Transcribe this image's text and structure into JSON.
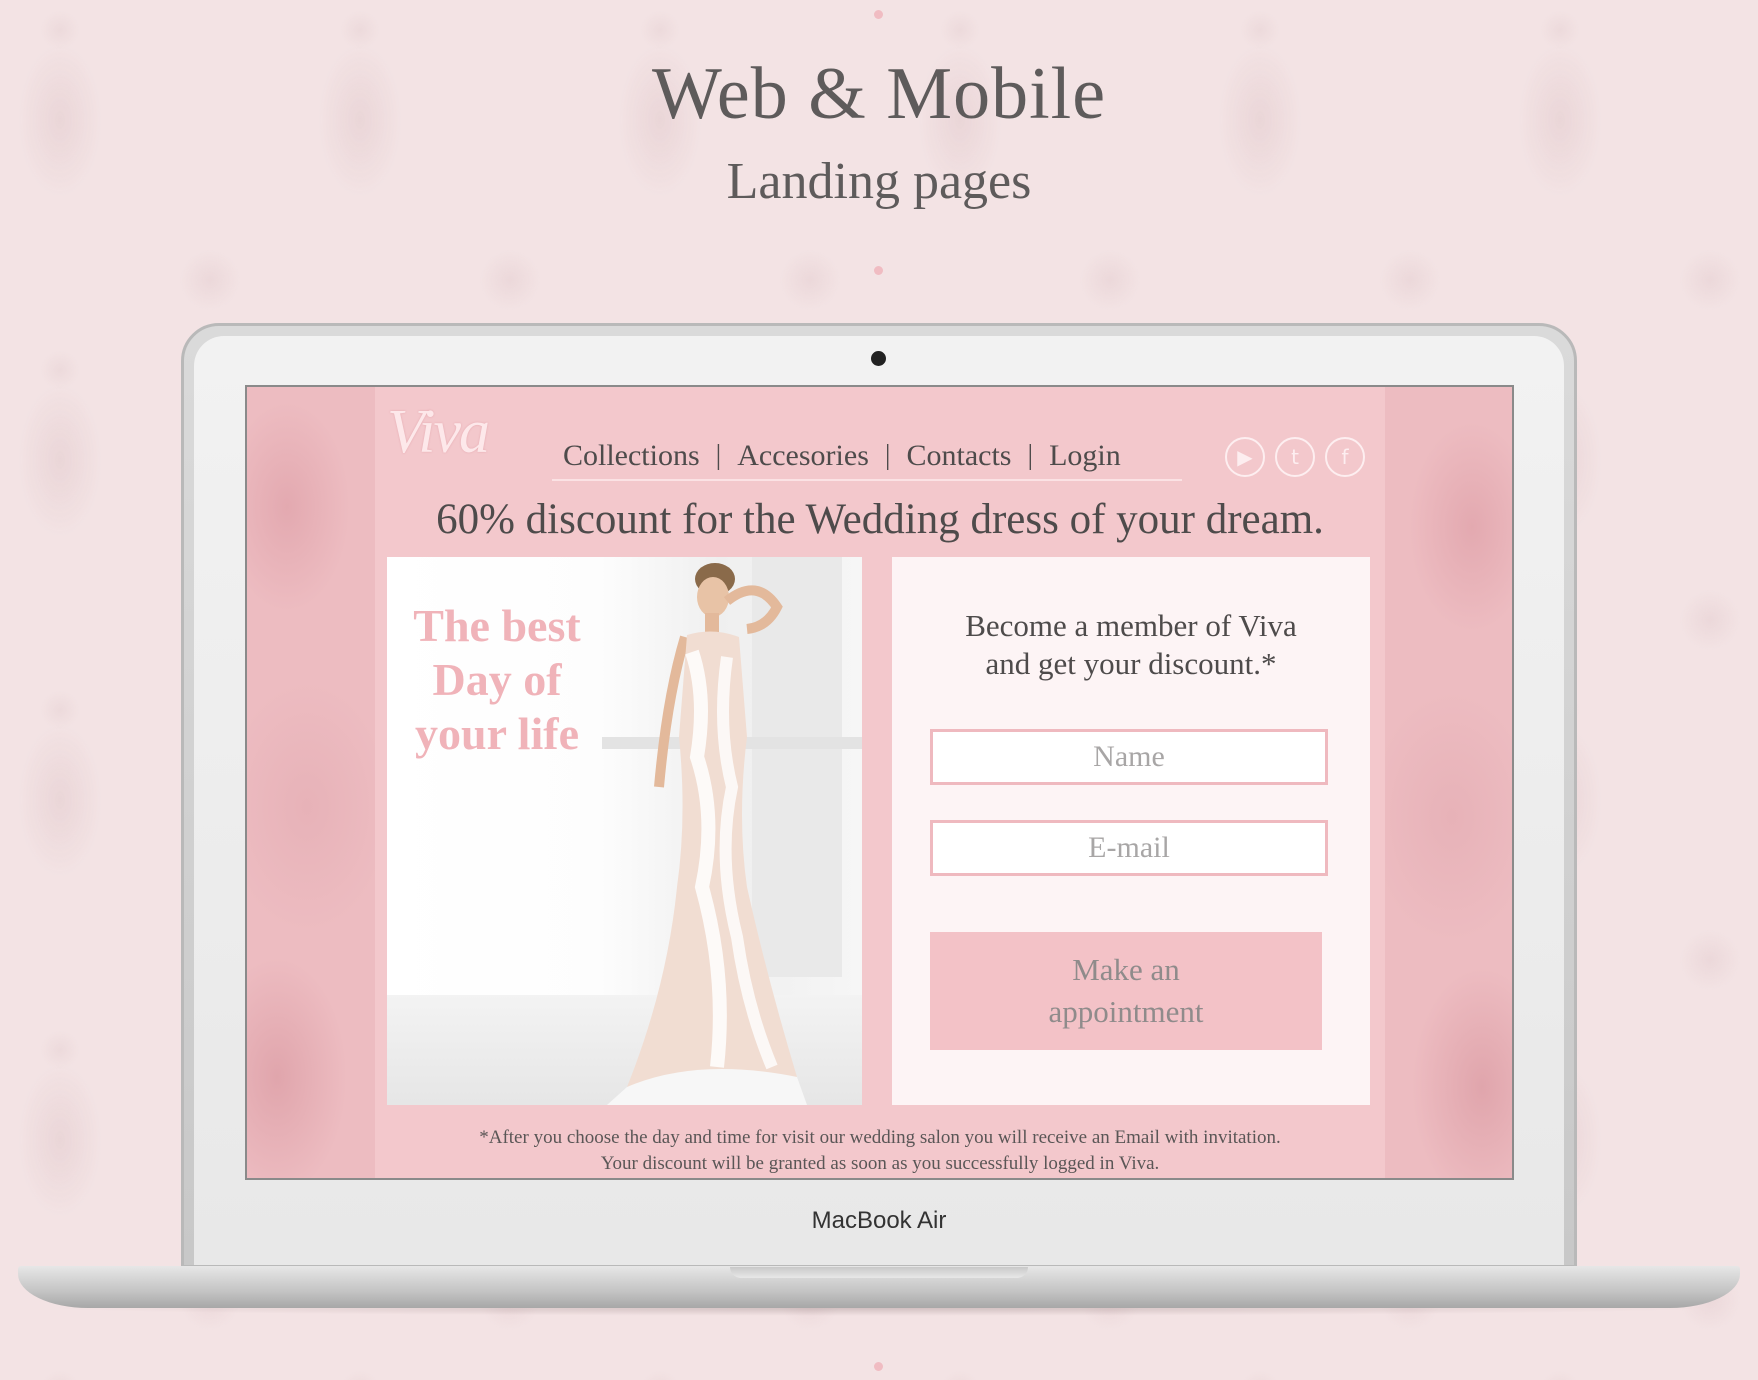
{
  "page": {
    "heading": "Web & Mobile",
    "subheading": "Landing pages"
  },
  "device": {
    "brand_label": "MacBook Air"
  },
  "site": {
    "logo_text": "Viva",
    "nav": [
      "Collections",
      "Accesories",
      "Contacts",
      "Login"
    ],
    "nav_separator": "|",
    "social": [
      {
        "icon": "youtube-icon",
        "glyph": "▶"
      },
      {
        "icon": "twitter-icon",
        "glyph": "t"
      },
      {
        "icon": "facebook-icon",
        "glyph": "f"
      }
    ],
    "headline": "60% discount for the Wedding dress of your dream.",
    "tagline": "The best Day of your life",
    "form": {
      "title_line1": "Become a member of Viva",
      "title_line2": "and get your discount.*",
      "name_placeholder": "Name",
      "email_placeholder": "E-mail",
      "button_line1": "Make an",
      "button_line2": "appointment"
    },
    "footnote_line1": "*After you choose the day and time for visit our wedding salon you will receive an Email with invitation.",
    "footnote_line2": "Your discount will be granted as soon as you successfully logged in Viva."
  },
  "colors": {
    "background": "#f3e3e4",
    "site_pink": "#f3c8cc",
    "accent_pink": "#f0b3b9",
    "text_dark": "#4e4b4b"
  }
}
